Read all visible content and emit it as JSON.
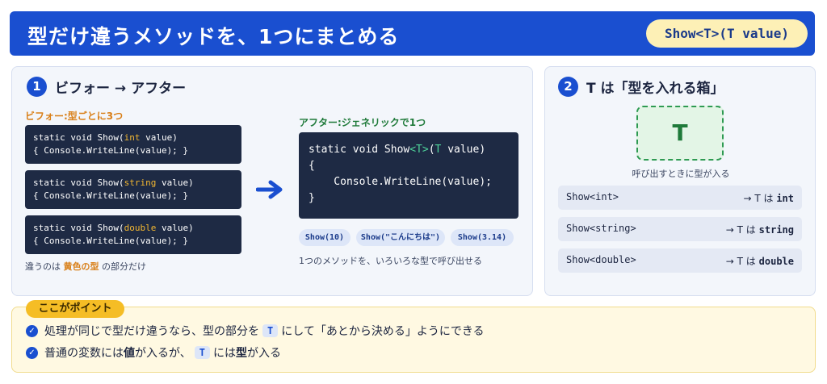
{
  "header": {
    "title": "型だけ違うメソッドを、1つにまとめる",
    "signature": "Show<T>(T value)"
  },
  "before_after": {
    "number": "1",
    "title": "ビフォー → アフター",
    "before_label": "ビフォー:型ごとに3つ",
    "before_codes": [
      {
        "pre": "static void Show(",
        "type": "int",
        "post": " value)",
        "line2": "{ Console.WriteLine(value); }"
      },
      {
        "pre": "static void Show(",
        "type": "string",
        "post": " value)",
        "line2": "{ Console.WriteLine(value); }"
      },
      {
        "pre": "static void Show(",
        "type": "double",
        "post": " value)",
        "line2": "{ Console.WriteLine(value); }"
      }
    ],
    "before_note_pre": "違うのは",
    "before_note_highlight": "黄色の型",
    "before_note_post": "の部分だけ",
    "after_label": "アフター:ジェネリックで1つ",
    "after_code": {
      "l1_pre": "static void Show",
      "l1_tag": "<T>",
      "l1_paren": "(",
      "l1_t": "T",
      "l1_post": " value)",
      "l2": "{",
      "l3": "    Console.WriteLine(value);",
      "l4": "}"
    },
    "calls": [
      "Show(10)",
      "Show(\"こんにちは\")",
      "Show(3.14)"
    ],
    "after_note": "1つのメソッドを、いろいろな型で呼び出せる"
  },
  "type_box": {
    "number": "2",
    "title": "T は「型を入れる箱」",
    "box_letter": "T",
    "caption": "呼び出すときに型が入る",
    "rows": [
      {
        "call": "Show<int>",
        "arrow_text": "→ T は",
        "type": "int"
      },
      {
        "call": "Show<string>",
        "arrow_text": "→ T は",
        "type": "string"
      },
      {
        "call": "Show<double>",
        "arrow_text": "→ T は",
        "type": "double"
      }
    ]
  },
  "points": {
    "badge": "ここがポイント",
    "line1_pre": "処理が同じで型だけ違うなら、型の部分を",
    "line1_chip": "T",
    "line1_post": "にして「あとから決める」ようにできる",
    "line2_pre": "普通の変数には",
    "line2_bold1": "値",
    "line2_mid1": "が入るが、",
    "line2_chip": "T",
    "line2_mid2": "には",
    "line2_bold2": "型",
    "line2_post": "が入る"
  },
  "colors": {
    "primary": "#1a4fd0",
    "code_bg": "#1e2a44",
    "keyword_yellow": "#f2b731",
    "generic_green": "#4fd39a",
    "point_yellow": "#f5bd25"
  }
}
